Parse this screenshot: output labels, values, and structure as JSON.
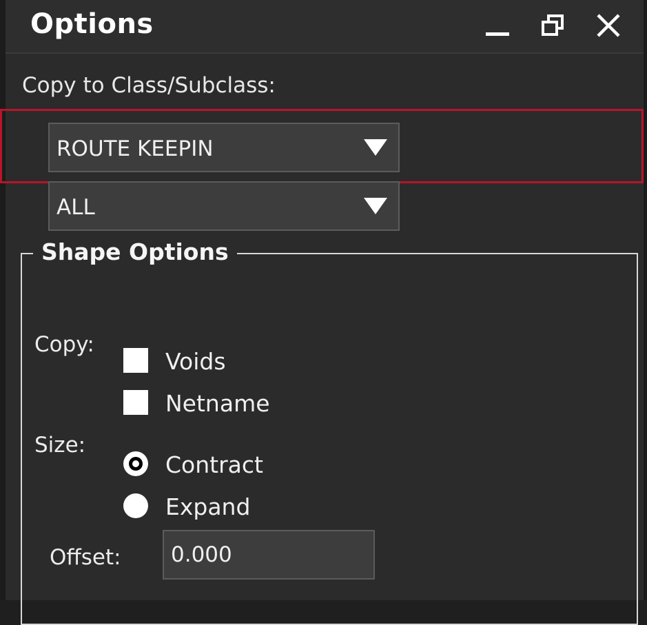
{
  "window": {
    "title": "Options",
    "controls": [
      "minimize-icon",
      "restore-icon",
      "close-icon"
    ]
  },
  "copy_to": {
    "label": "Copy to Class/Subclass:",
    "class_value": "ROUTE KEEPIN",
    "subclass_value": "ALL"
  },
  "shape_options": {
    "title": "Shape Options",
    "copy_label": "Copy:",
    "copy_options": [
      {
        "label": "Voids",
        "checked": false
      },
      {
        "label": "Netname",
        "checked": false
      }
    ],
    "size_label": "Size:",
    "size_options": [
      {
        "label": "Contract",
        "selected": true
      },
      {
        "label": "Expand",
        "selected": false
      }
    ],
    "offset_label": "Offset:",
    "offset_value": "0.000"
  },
  "colors": {
    "background": "#2b2b2b",
    "highlight": "#b8152a",
    "field": "#3d3d3d"
  }
}
